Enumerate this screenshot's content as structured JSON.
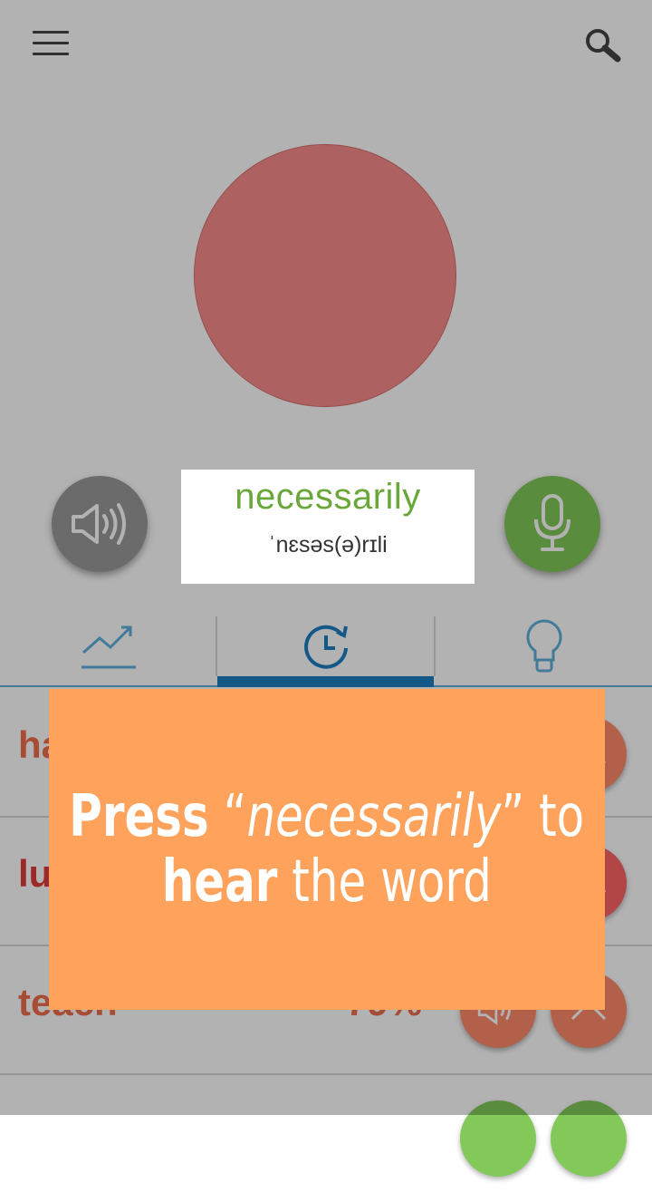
{
  "word_card": {
    "word": "necessarily",
    "ipa": "ˈnɛsəs(ə)rɪli"
  },
  "tabs": [
    {
      "icon": "trend-chart-icon"
    },
    {
      "icon": "refresh-clock-icon"
    },
    {
      "icon": "lightbulb-icon"
    }
  ],
  "rows": [
    {
      "word": "ha",
      "percent": "",
      "color": "#f06e4c",
      "btn1_color": "#ff8a6b",
      "btn2_color": "#ff8a6b"
    },
    {
      "word": "lu",
      "percent": "",
      "color": "#e03c3c",
      "btn1_color": "#ff6464",
      "btn2_color": "#ff6464"
    },
    {
      "word": "teach",
      "percent": "79%",
      "color": "#f06e4c",
      "btn1_color": "#ff8a6b",
      "btn2_color": "#ff8a6b"
    },
    {
      "word": "",
      "percent": "",
      "color": "#82c95a",
      "btn1_color": "#82c95a",
      "btn2_color": "#82c95a"
    }
  ],
  "tooltip": {
    "press": "Press",
    "open_quote": "“",
    "word": "necessarily",
    "close_quote": "”",
    "to": "to",
    "hear": "hear",
    "rest": "the word"
  },
  "colors": {
    "accent_blue": "#1e7fc2",
    "green": "#82c95a",
    "tooltip_bg": "#ffa25c"
  }
}
